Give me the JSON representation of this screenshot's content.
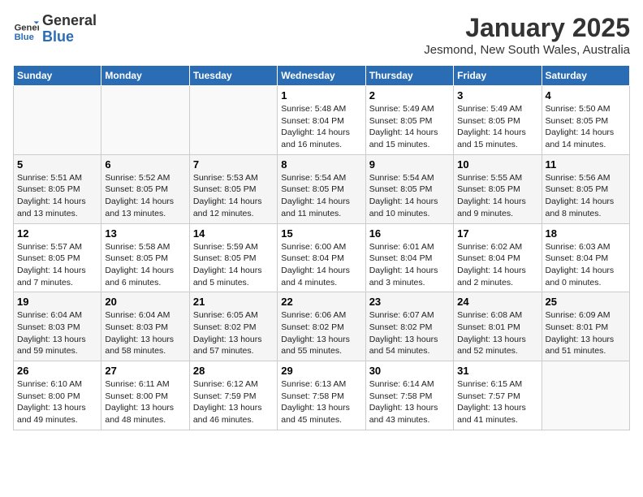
{
  "header": {
    "logo_line1": "General",
    "logo_line2": "Blue",
    "month_title": "January 2025",
    "location": "Jesmond, New South Wales, Australia"
  },
  "weekdays": [
    "Sunday",
    "Monday",
    "Tuesday",
    "Wednesday",
    "Thursday",
    "Friday",
    "Saturday"
  ],
  "weeks": [
    [
      {
        "day": "",
        "sunrise": "",
        "sunset": "",
        "daylight": ""
      },
      {
        "day": "",
        "sunrise": "",
        "sunset": "",
        "daylight": ""
      },
      {
        "day": "",
        "sunrise": "",
        "sunset": "",
        "daylight": ""
      },
      {
        "day": "1",
        "sunrise": "Sunrise: 5:48 AM",
        "sunset": "Sunset: 8:04 PM",
        "daylight": "Daylight: 14 hours and 16 minutes."
      },
      {
        "day": "2",
        "sunrise": "Sunrise: 5:49 AM",
        "sunset": "Sunset: 8:05 PM",
        "daylight": "Daylight: 14 hours and 15 minutes."
      },
      {
        "day": "3",
        "sunrise": "Sunrise: 5:49 AM",
        "sunset": "Sunset: 8:05 PM",
        "daylight": "Daylight: 14 hours and 15 minutes."
      },
      {
        "day": "4",
        "sunrise": "Sunrise: 5:50 AM",
        "sunset": "Sunset: 8:05 PM",
        "daylight": "Daylight: 14 hours and 14 minutes."
      }
    ],
    [
      {
        "day": "5",
        "sunrise": "Sunrise: 5:51 AM",
        "sunset": "Sunset: 8:05 PM",
        "daylight": "Daylight: 14 hours and 13 minutes."
      },
      {
        "day": "6",
        "sunrise": "Sunrise: 5:52 AM",
        "sunset": "Sunset: 8:05 PM",
        "daylight": "Daylight: 14 hours and 13 minutes."
      },
      {
        "day": "7",
        "sunrise": "Sunrise: 5:53 AM",
        "sunset": "Sunset: 8:05 PM",
        "daylight": "Daylight: 14 hours and 12 minutes."
      },
      {
        "day": "8",
        "sunrise": "Sunrise: 5:54 AM",
        "sunset": "Sunset: 8:05 PM",
        "daylight": "Daylight: 14 hours and 11 minutes."
      },
      {
        "day": "9",
        "sunrise": "Sunrise: 5:54 AM",
        "sunset": "Sunset: 8:05 PM",
        "daylight": "Daylight: 14 hours and 10 minutes."
      },
      {
        "day": "10",
        "sunrise": "Sunrise: 5:55 AM",
        "sunset": "Sunset: 8:05 PM",
        "daylight": "Daylight: 14 hours and 9 minutes."
      },
      {
        "day": "11",
        "sunrise": "Sunrise: 5:56 AM",
        "sunset": "Sunset: 8:05 PM",
        "daylight": "Daylight: 14 hours and 8 minutes."
      }
    ],
    [
      {
        "day": "12",
        "sunrise": "Sunrise: 5:57 AM",
        "sunset": "Sunset: 8:05 PM",
        "daylight": "Daylight: 14 hours and 7 minutes."
      },
      {
        "day": "13",
        "sunrise": "Sunrise: 5:58 AM",
        "sunset": "Sunset: 8:05 PM",
        "daylight": "Daylight: 14 hours and 6 minutes."
      },
      {
        "day": "14",
        "sunrise": "Sunrise: 5:59 AM",
        "sunset": "Sunset: 8:05 PM",
        "daylight": "Daylight: 14 hours and 5 minutes."
      },
      {
        "day": "15",
        "sunrise": "Sunrise: 6:00 AM",
        "sunset": "Sunset: 8:04 PM",
        "daylight": "Daylight: 14 hours and 4 minutes."
      },
      {
        "day": "16",
        "sunrise": "Sunrise: 6:01 AM",
        "sunset": "Sunset: 8:04 PM",
        "daylight": "Daylight: 14 hours and 3 minutes."
      },
      {
        "day": "17",
        "sunrise": "Sunrise: 6:02 AM",
        "sunset": "Sunset: 8:04 PM",
        "daylight": "Daylight: 14 hours and 2 minutes."
      },
      {
        "day": "18",
        "sunrise": "Sunrise: 6:03 AM",
        "sunset": "Sunset: 8:04 PM",
        "daylight": "Daylight: 14 hours and 0 minutes."
      }
    ],
    [
      {
        "day": "19",
        "sunrise": "Sunrise: 6:04 AM",
        "sunset": "Sunset: 8:03 PM",
        "daylight": "Daylight: 13 hours and 59 minutes."
      },
      {
        "day": "20",
        "sunrise": "Sunrise: 6:04 AM",
        "sunset": "Sunset: 8:03 PM",
        "daylight": "Daylight: 13 hours and 58 minutes."
      },
      {
        "day": "21",
        "sunrise": "Sunrise: 6:05 AM",
        "sunset": "Sunset: 8:02 PM",
        "daylight": "Daylight: 13 hours and 57 minutes."
      },
      {
        "day": "22",
        "sunrise": "Sunrise: 6:06 AM",
        "sunset": "Sunset: 8:02 PM",
        "daylight": "Daylight: 13 hours and 55 minutes."
      },
      {
        "day": "23",
        "sunrise": "Sunrise: 6:07 AM",
        "sunset": "Sunset: 8:02 PM",
        "daylight": "Daylight: 13 hours and 54 minutes."
      },
      {
        "day": "24",
        "sunrise": "Sunrise: 6:08 AM",
        "sunset": "Sunset: 8:01 PM",
        "daylight": "Daylight: 13 hours and 52 minutes."
      },
      {
        "day": "25",
        "sunrise": "Sunrise: 6:09 AM",
        "sunset": "Sunset: 8:01 PM",
        "daylight": "Daylight: 13 hours and 51 minutes."
      }
    ],
    [
      {
        "day": "26",
        "sunrise": "Sunrise: 6:10 AM",
        "sunset": "Sunset: 8:00 PM",
        "daylight": "Daylight: 13 hours and 49 minutes."
      },
      {
        "day": "27",
        "sunrise": "Sunrise: 6:11 AM",
        "sunset": "Sunset: 8:00 PM",
        "daylight": "Daylight: 13 hours and 48 minutes."
      },
      {
        "day": "28",
        "sunrise": "Sunrise: 6:12 AM",
        "sunset": "Sunset: 7:59 PM",
        "daylight": "Daylight: 13 hours and 46 minutes."
      },
      {
        "day": "29",
        "sunrise": "Sunrise: 6:13 AM",
        "sunset": "Sunset: 7:58 PM",
        "daylight": "Daylight: 13 hours and 45 minutes."
      },
      {
        "day": "30",
        "sunrise": "Sunrise: 6:14 AM",
        "sunset": "Sunset: 7:58 PM",
        "daylight": "Daylight: 13 hours and 43 minutes."
      },
      {
        "day": "31",
        "sunrise": "Sunrise: 6:15 AM",
        "sunset": "Sunset: 7:57 PM",
        "daylight": "Daylight: 13 hours and 41 minutes."
      },
      {
        "day": "",
        "sunrise": "",
        "sunset": "",
        "daylight": ""
      }
    ]
  ]
}
